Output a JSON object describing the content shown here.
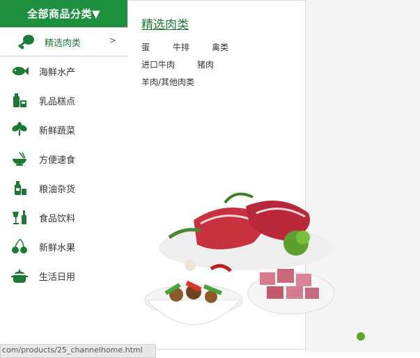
{
  "header": {
    "title": "全部商品分类▼"
  },
  "sidebar": {
    "active_arrow": ">",
    "items": [
      {
        "label": "精选肉类",
        "icon": "meat-drumstick-icon"
      },
      {
        "label": "海鲜水产",
        "icon": "fish-icon"
      },
      {
        "label": "乳品糕点",
        "icon": "milk-bottle-icon"
      },
      {
        "label": "新鲜蔬菜",
        "icon": "vegetable-leaf-icon"
      },
      {
        "label": "方便速食",
        "icon": "noodle-bowl-icon"
      },
      {
        "label": "粮油杂货",
        "icon": "oil-bottle-icon"
      },
      {
        "label": "食品饮料",
        "icon": "wine-glass-icon"
      },
      {
        "label": "新鲜水果",
        "icon": "cherry-icon"
      },
      {
        "label": "生活日用",
        "icon": "cooking-pot-icon"
      }
    ]
  },
  "panel": {
    "title": "精选肉类",
    "links": [
      "蛋",
      "牛排",
      "禽类",
      "进口牛肉",
      "猪肉",
      "羊肉/其他肉类"
    ]
  },
  "status": {
    "url": "com/products/25_channelhome.html"
  },
  "colors": {
    "accent": "#1e8f3e",
    "icon": "#1b7a36",
    "dot": "#5da82b"
  }
}
